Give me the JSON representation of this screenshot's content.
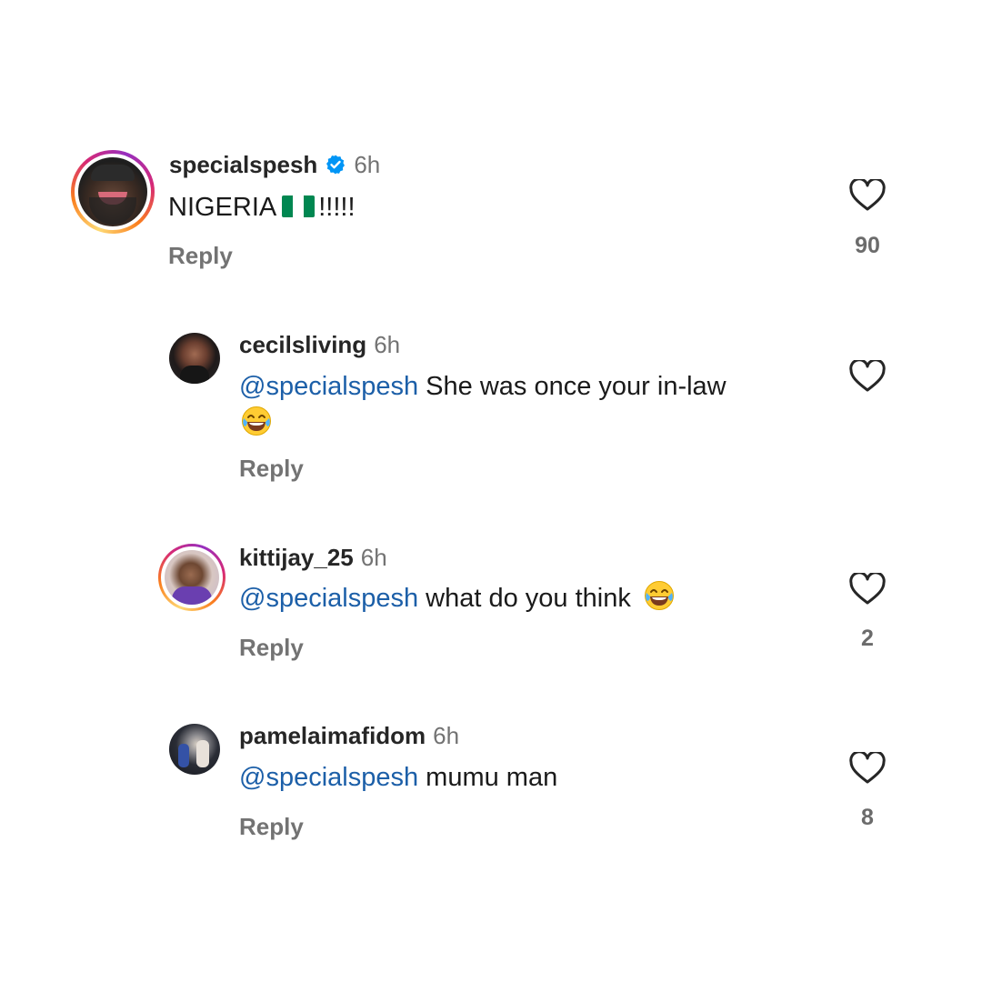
{
  "comments": [
    {
      "username": "specialspesh",
      "time": "6h",
      "verified": true,
      "text_prefix": "NIGERIA",
      "text_suffix": "!!!!!",
      "flag_icon": "nigeria-flag",
      "reply_label": "Reply",
      "likes": "90",
      "story_ring": true
    },
    {
      "username": "cecilsliving",
      "time": "6h",
      "mention": "@specialspesh",
      "text": "She was once your in-law",
      "emoji_icon": "face-with-tears-of-joy",
      "reply_label": "Reply",
      "likes": "",
      "story_ring": false
    },
    {
      "username": "kittijay_25",
      "time": "6h",
      "mention": "@specialspesh",
      "text": "what do you think",
      "emoji_icon": "face-with-tears-of-joy",
      "reply_label": "Reply",
      "likes": "2",
      "story_ring": true
    },
    {
      "username": "pamelaimafidom",
      "time": "6h",
      "mention": "@specialspesh",
      "text": "mumu man",
      "reply_label": "Reply",
      "likes": "8",
      "story_ring": false
    }
  ],
  "colors": {
    "mention": "#1c5fa8",
    "secondary_text": "#737373",
    "verified_badge": "#0095f6",
    "flag_green": "#008751"
  }
}
